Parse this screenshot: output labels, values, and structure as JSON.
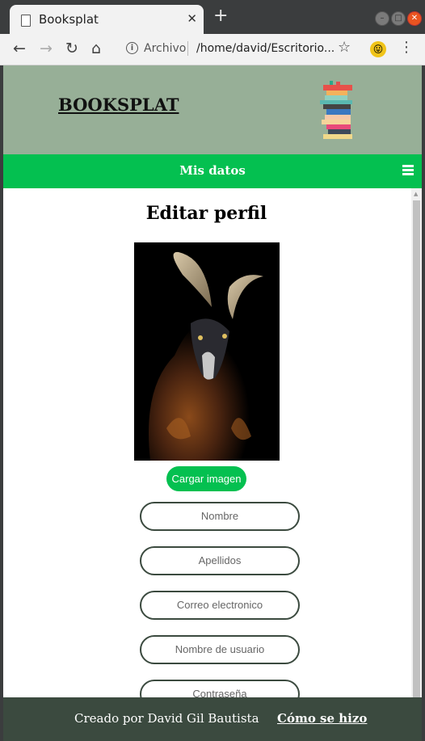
{
  "browser": {
    "tab_title": "Booksplat",
    "tab_close": "✕",
    "new_tab": "+",
    "url_scheme": "Archivo",
    "url_path": "/home/david/Escritorio..."
  },
  "site": {
    "title": "BOOKSPLAT",
    "nav_title": "Mis datos"
  },
  "main": {
    "heading": "Editar perfil",
    "upload_label": "Cargar imagen",
    "fields": [
      {
        "placeholder": "Nombre"
      },
      {
        "placeholder": "Apellidos"
      },
      {
        "placeholder": "Correo electronico"
      },
      {
        "placeholder": "Nombre de usuario"
      },
      {
        "placeholder": "Contraseña"
      }
    ]
  },
  "footer": {
    "credit": "Creado por David Gil Bautista",
    "link": "Cómo se hizo"
  },
  "colors": {
    "header_bg": "#97af97",
    "nav_bg": "#04c050",
    "footer_bg": "#3b4a3f"
  }
}
